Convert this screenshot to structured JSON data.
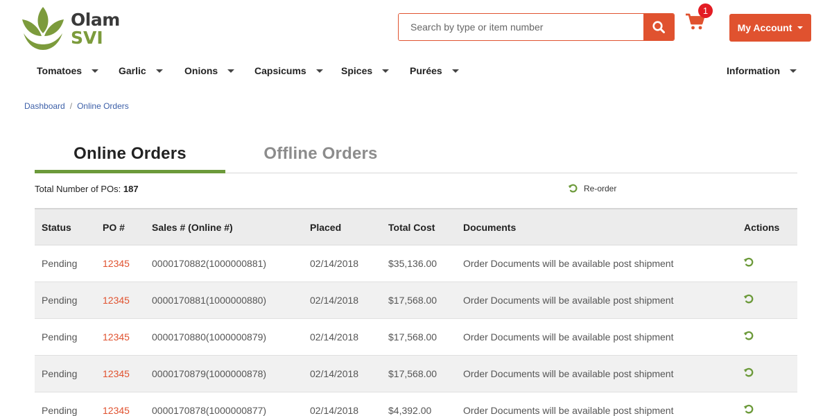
{
  "brand": {
    "name_line1": "Olam",
    "name_line2": "SVI"
  },
  "search": {
    "placeholder": "Search by type or item number"
  },
  "cart": {
    "count": "1"
  },
  "account": {
    "label": "My Account"
  },
  "nav": {
    "items": [
      "Tomatoes",
      "Garlic",
      "Onions",
      "Capsicums",
      "Spices",
      "Purées"
    ],
    "information": "Information"
  },
  "breadcrumb": {
    "home": "Dashboard",
    "separator": "/",
    "current": "Online Orders"
  },
  "tabs": {
    "online": "Online Orders",
    "offline": "Offline Orders"
  },
  "summary": {
    "label": "Total Number of POs:",
    "count": "187"
  },
  "reorder": {
    "label": "Re-order"
  },
  "table": {
    "headers": {
      "status": "Status",
      "po": "PO #",
      "sales": "Sales # (Online #)",
      "placed": "Placed",
      "total": "Total Cost",
      "documents": "Documents",
      "actions": "Actions"
    },
    "rows": [
      {
        "status": "Pending",
        "po": "12345",
        "sales": "0000170882(1000000881)",
        "placed": "02/14/2018",
        "total": "$35,136.00",
        "documents": "Order Documents will be available post shipment"
      },
      {
        "status": "Pending",
        "po": "12345",
        "sales": "0000170881(1000000880)",
        "placed": "02/14/2018",
        "total": "$17,568.00",
        "documents": "Order Documents will be available post shipment"
      },
      {
        "status": "Pending",
        "po": "12345",
        "sales": "0000170880(1000000879)",
        "placed": "02/14/2018",
        "total": "$17,568.00",
        "documents": "Order Documents will be available post shipment"
      },
      {
        "status": "Pending",
        "po": "12345",
        "sales": "0000170879(1000000878)",
        "placed": "02/14/2018",
        "total": "$17,568.00",
        "documents": "Order Documents will be available post shipment"
      },
      {
        "status": "Pending",
        "po": "12345",
        "sales": "0000170878(1000000877)",
        "placed": "02/14/2018",
        "total": "$4,392.00",
        "documents": "Order Documents will be available post shipment"
      }
    ]
  },
  "colors": {
    "accent": "#e0522f",
    "green": "#6c9a3a",
    "badge": "#e31c23",
    "link": "#3c5fa8"
  },
  "icons": {
    "search": "search-icon",
    "cart": "cart-icon",
    "reorder": "reorder-icon"
  }
}
